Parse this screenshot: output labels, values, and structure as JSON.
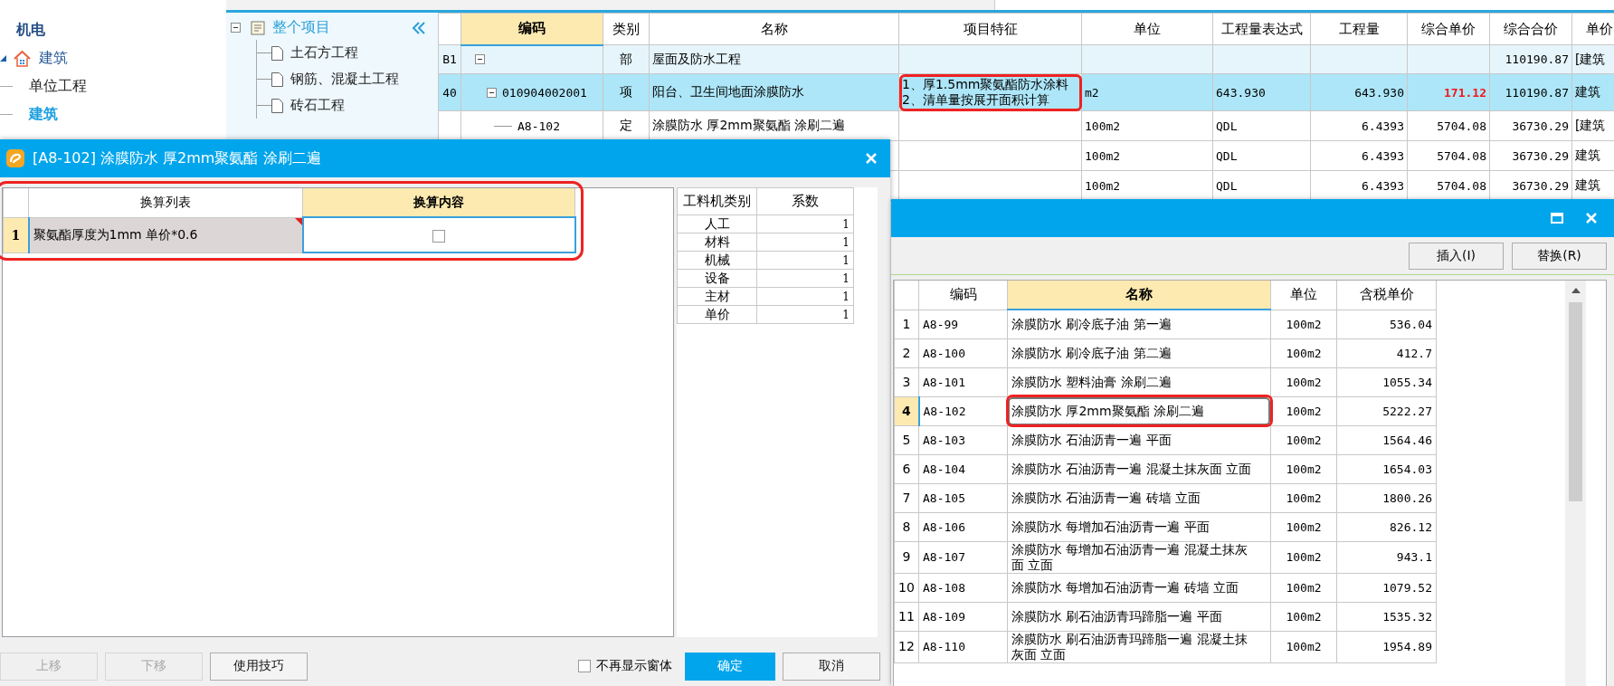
{
  "sidebar": {
    "items": [
      {
        "label": "机电",
        "kind": "group",
        "selected": false
      },
      {
        "label": "建筑",
        "kind": "folder",
        "selected": false,
        "expanded": true,
        "children": [
          {
            "label": "单位工程",
            "kind": "leaf",
            "selected": false
          },
          {
            "label": "建筑",
            "kind": "leaf",
            "selected": true
          }
        ]
      }
    ]
  },
  "project_tree": {
    "root": {
      "label": "整个项目",
      "expanded": true,
      "selected": true,
      "children": [
        {
          "label": "土石方工程",
          "selected": false
        },
        {
          "label": "钢筋、混凝土工程",
          "selected": false
        },
        {
          "label": "砖石工程",
          "selected": false
        }
      ]
    }
  },
  "bill_table": {
    "columns": [
      {
        "label": "编码",
        "selected": true
      },
      {
        "label": "类别",
        "selected": false
      },
      {
        "label": "名称",
        "selected": false
      },
      {
        "label": "项目特征",
        "selected": false
      },
      {
        "label": "单位",
        "selected": false
      },
      {
        "label": "工程量表达式",
        "selected": false
      },
      {
        "label": "工程量",
        "selected": false
      },
      {
        "label": "综合单价",
        "selected": false
      },
      {
        "label": "综合合价",
        "selected": false
      },
      {
        "label": "单价",
        "selected": false
      }
    ],
    "rows": [
      {
        "number": "B1",
        "kind": "section",
        "expanded": true,
        "selected": false,
        "highlighted": false,
        "type": "部",
        "name": "屋面及防水工程",
        "price_changed": false,
        "total_price": "110190.87",
        "column_11": "[建筑"
      },
      {
        "number": "40",
        "kind": "item",
        "expanded": true,
        "selected": true,
        "highlighted": true,
        "code": "010904002001",
        "type": "项",
        "name": "阳台、卫生间地面涂膜防水",
        "feature": "1、厚1.5mm聚氨酯防水涂料\n2、清单量按展开面积计算",
        "unit": "m2",
        "expression": "643.930",
        "quantity": "643.930",
        "unit_price": "171.12",
        "price_changed": true,
        "total_price": "110190.87",
        "column_11": "建筑"
      },
      {
        "kind": "quota",
        "selected": false,
        "highlighted": false,
        "code": "A8-102",
        "type": "定",
        "name": "涂膜防水 厚2mm聚氨酯 涂刷二遍",
        "unit": "100m2",
        "expression": "QDL",
        "quantity": "6.4393",
        "unit_price": "5704.08",
        "price_changed": false,
        "total_price": "36730.29",
        "column_11": "[建筑"
      },
      {
        "kind": "quota",
        "selected": false,
        "highlighted": false,
        "unit": "100m2",
        "expression": "QDL",
        "quantity": "6.4393",
        "unit_price": "5704.08",
        "price_changed": false,
        "total_price": "36730.29",
        "column_11": "建筑"
      },
      {
        "kind": "quota",
        "selected": false,
        "highlighted": false,
        "unit": "100m2",
        "expression": "QDL",
        "quantity": "6.4393",
        "unit_price": "5704.08",
        "price_changed": false,
        "total_price": "36730.29",
        "column_11": "建筑"
      }
    ]
  },
  "convert_dialog": {
    "title": "[A8-102] 涂膜防水 厚2mm聚氨酯 涂刷二遍",
    "list": {
      "highlighted": true,
      "columns": [
        {
          "label": "换算列表",
          "selected": false
        },
        {
          "label": "换算内容",
          "selected": true
        }
      ],
      "rows": [
        {
          "number": "1",
          "name": "聚氨酯厚度为1mm 单价*0.6",
          "checked": false,
          "selected": true
        }
      ]
    },
    "factors": {
      "columns": [
        "工料机类别",
        "系数"
      ],
      "rows": [
        {
          "category": "人工",
          "factor": "1"
        },
        {
          "category": "材料",
          "factor": "1"
        },
        {
          "category": "机械",
          "factor": "1"
        },
        {
          "category": "设备",
          "factor": "1"
        },
        {
          "category": "主材",
          "factor": "1"
        },
        {
          "category": "单价",
          "factor": "1"
        }
      ]
    },
    "buttons": [
      {
        "label": "上移",
        "kind": "normal",
        "disabled": true
      },
      {
        "label": "下移",
        "kind": "normal",
        "disabled": true
      },
      {
        "label": "使用技巧",
        "kind": "normal",
        "disabled": false
      }
    ],
    "dont_show_again": {
      "label": "不再显示窗体",
      "checked": false
    },
    "actions": [
      {
        "label": "确定",
        "kind": "primary",
        "disabled": false
      },
      {
        "label": "取消",
        "kind": "normal",
        "disabled": false
      }
    ]
  },
  "library_panel": {
    "toolbar_buttons": [
      "插入(I)",
      "替换(R)"
    ],
    "columns": [
      {
        "label": "编码",
        "selected": false
      },
      {
        "label": "名称",
        "selected": true
      },
      {
        "label": "单位",
        "selected": false
      },
      {
        "label": "含税单价",
        "selected": false
      }
    ],
    "rows": [
      {
        "number": "1",
        "code": "A8-99",
        "name": "涂膜防水 刷冷底子油 第一遍",
        "unit": "100m2",
        "price": "536.04",
        "selected": false,
        "highlighted": false
      },
      {
        "number": "2",
        "code": "A8-100",
        "name": "涂膜防水 刷冷底子油 第二遍",
        "unit": "100m2",
        "price": "412.7",
        "selected": false,
        "highlighted": false
      },
      {
        "number": "3",
        "code": "A8-101",
        "name": "涂膜防水 塑料油膏 涂刷二遍",
        "unit": "100m2",
        "price": "1055.34",
        "selected": false,
        "highlighted": false
      },
      {
        "number": "4",
        "code": "A8-102",
        "name": "涂膜防水 厚2mm聚氨酯 涂刷二遍",
        "unit": "100m2",
        "price": "5222.27",
        "selected": true,
        "highlighted": true
      },
      {
        "number": "5",
        "code": "A8-103",
        "name": "涂膜防水 石油沥青一遍 平面",
        "unit": "100m2",
        "price": "1564.46",
        "selected": false,
        "highlighted": false
      },
      {
        "number": "6",
        "code": "A8-104",
        "name": "涂膜防水 石油沥青一遍 混凝土抹灰面 立面",
        "unit": "100m2",
        "price": "1654.03",
        "selected": false,
        "highlighted": false
      },
      {
        "number": "7",
        "code": "A8-105",
        "name": "涂膜防水 石油沥青一遍 砖墙 立面",
        "unit": "100m2",
        "price": "1800.26",
        "selected": false,
        "highlighted": false
      },
      {
        "number": "8",
        "code": "A8-106",
        "name": "涂膜防水 每增加石油沥青一遍 平面",
        "unit": "100m2",
        "price": "826.12",
        "selected": false,
        "highlighted": false
      },
      {
        "number": "9",
        "code": "A8-107",
        "name": "涂膜防水 每增加石油沥青一遍 混凝土抹灰面 立面",
        "unit": "100m2",
        "price": "943.1",
        "selected": false,
        "highlighted": false
      },
      {
        "number": "10",
        "code": "A8-108",
        "name": "涂膜防水 每增加石油沥青一遍 砖墙 立面",
        "unit": "100m2",
        "price": "1079.52",
        "selected": false,
        "highlighted": false
      },
      {
        "number": "11",
        "code": "A8-109",
        "name": "涂膜防水 刷石油沥青玛蹄脂一遍 平面",
        "unit": "100m2",
        "price": "1535.32",
        "selected": false,
        "highlighted": false
      },
      {
        "number": "12",
        "code": "A8-110",
        "name": "涂膜防水 刷石油沥青玛蹄脂一遍 混凝土抹灰面 立面",
        "unit": "100m2",
        "price": "1954.89",
        "selected": false,
        "highlighted": false
      }
    ]
  }
}
